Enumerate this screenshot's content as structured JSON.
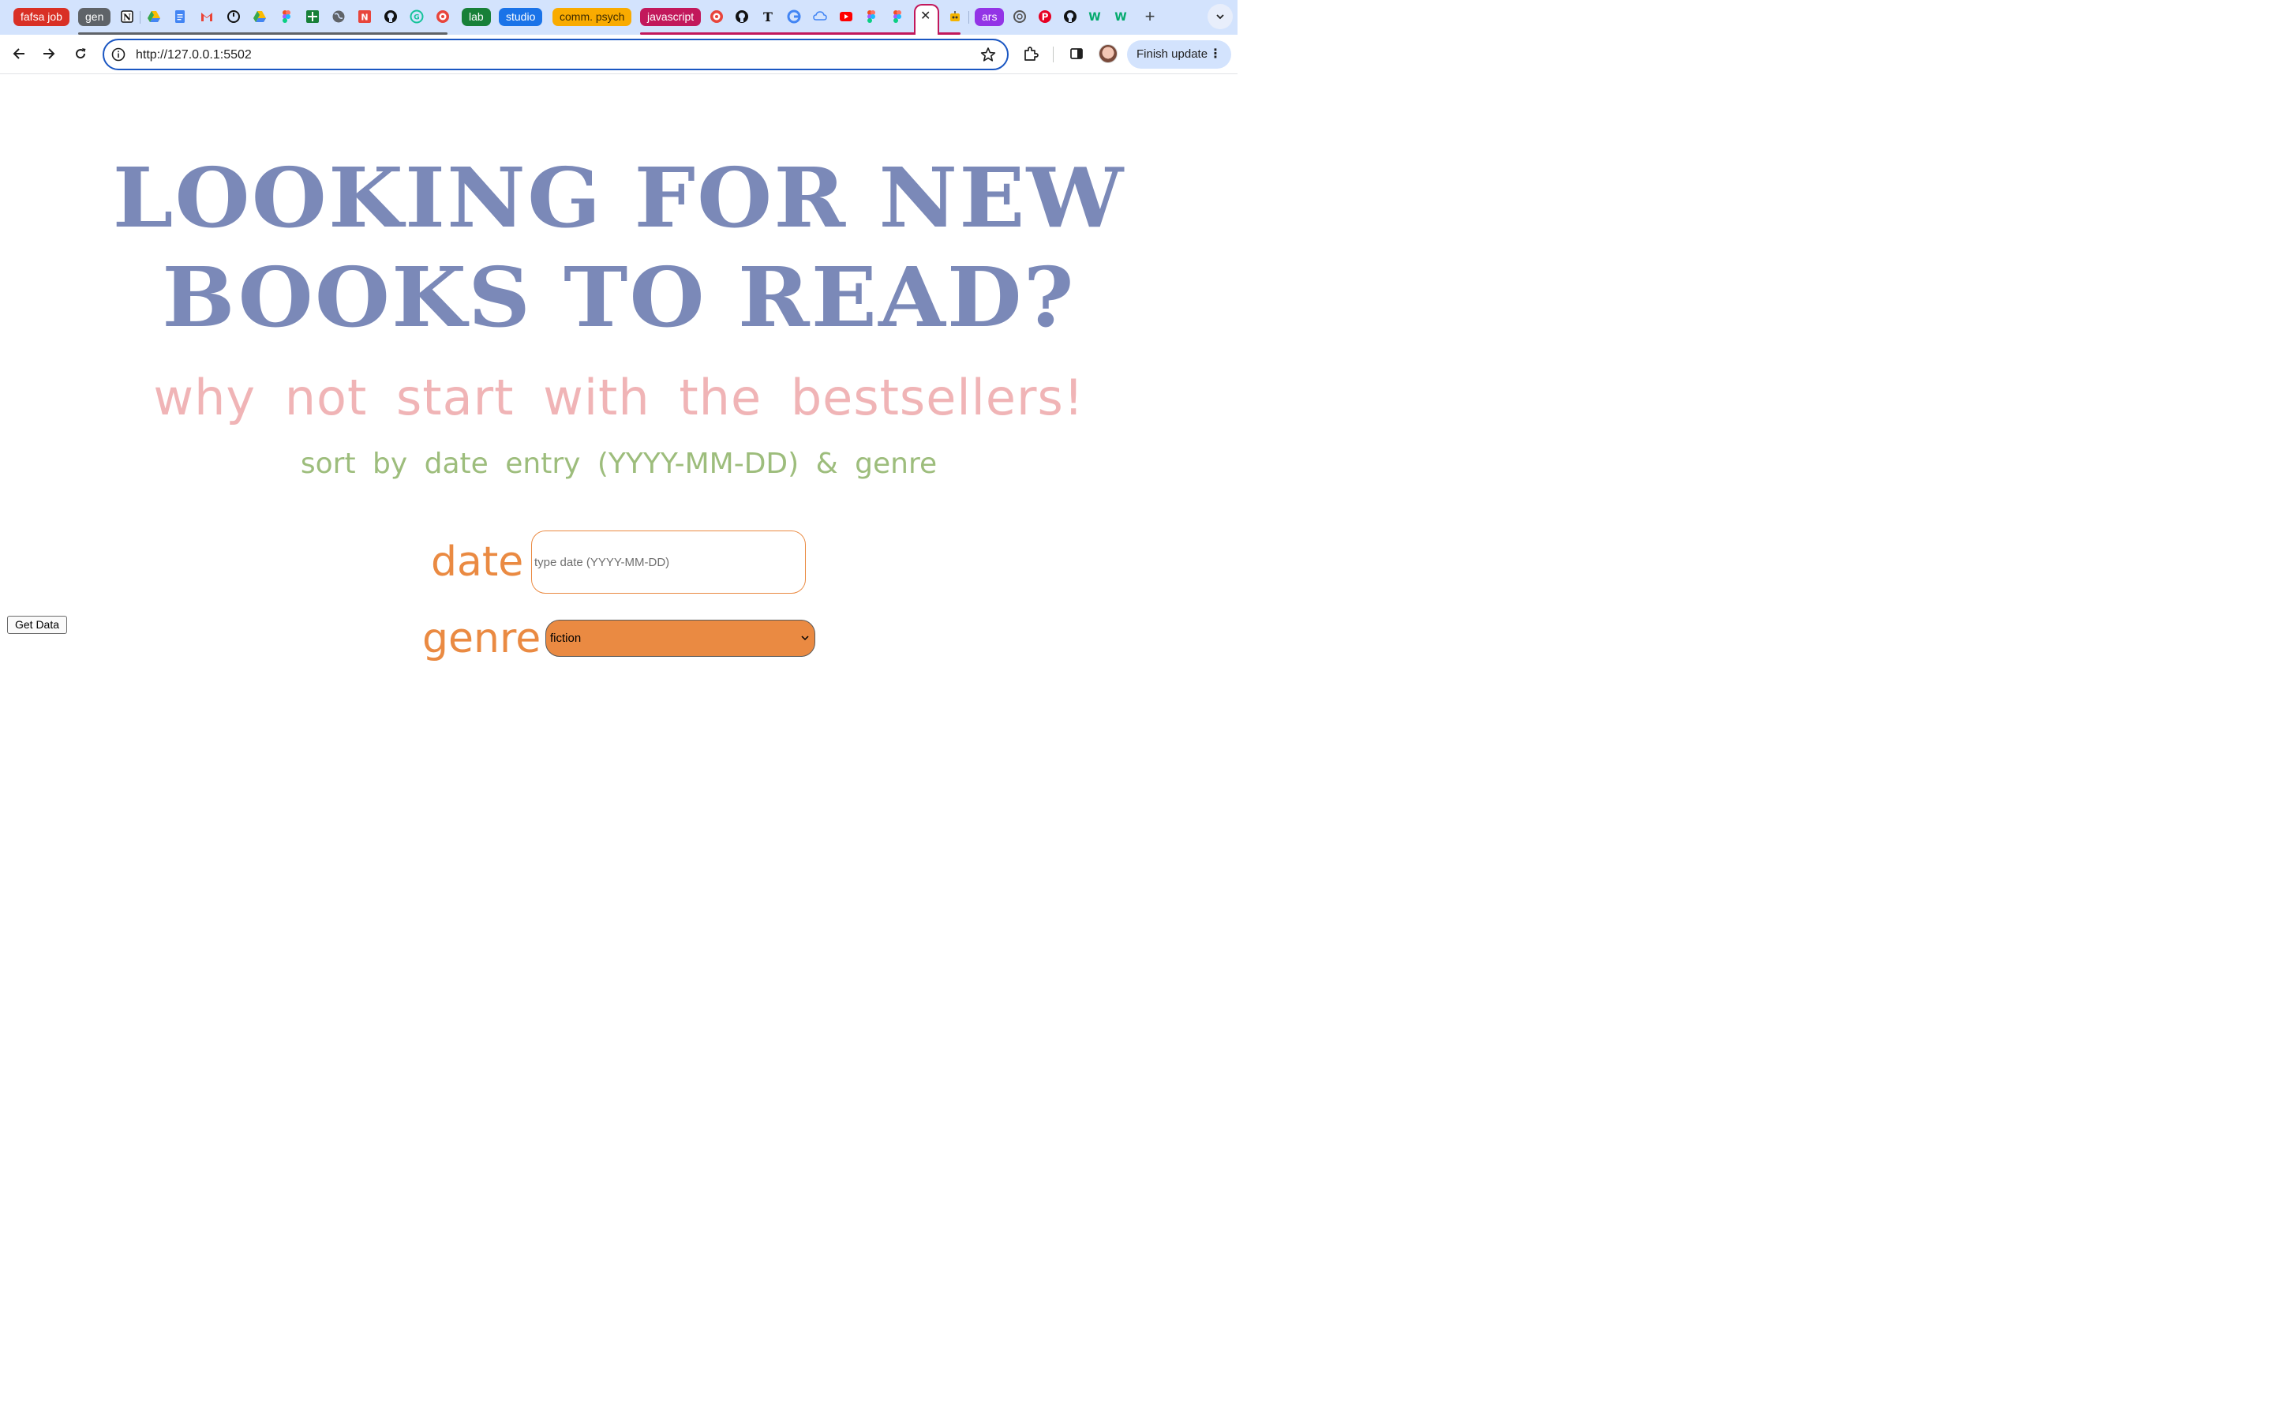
{
  "browser": {
    "tab_groups": [
      {
        "label": "fafsa job",
        "color": "#d93025"
      },
      {
        "label": "gen",
        "color": "#5f6368"
      },
      {
        "label": "lab",
        "color": "#188038"
      },
      {
        "label": "studio",
        "color": "#1a73e8"
      },
      {
        "label": "comm. psych",
        "color": "#f9ab00"
      },
      {
        "label": "javascript",
        "color": "#c2185b"
      },
      {
        "label": "ars",
        "color": "#9334e6"
      }
    ],
    "tab_icons": [
      "notion-icon",
      "google-drive-icon",
      "google-docs-icon",
      "gmail-icon",
      "timer-icon",
      "google-drive-icon",
      "figma-icon",
      "google-sheets-icon",
      "globe-icon",
      "news-icon",
      "github-icon",
      "grammarly-icon",
      "ucla-icon",
      "ucla-icon",
      "github-icon",
      "nytimes-icon",
      "google-icon",
      "cloud-icon",
      "youtube-icon",
      "figma-icon",
      "figma-icon",
      "bot-icon",
      "chatgpt-icon",
      "pinterest-icon",
      "github-icon",
      "w3schools-icon",
      "w3schools-icon"
    ],
    "active_tab_close": "✕",
    "new_tab": "+",
    "address": "http://127.0.0.1:5502",
    "update_button": "Finish update",
    "update_menu": "⋮"
  },
  "page": {
    "headline_line1": "LOOKING FOR NEW",
    "headline_line2": "BOOKS TO READ?",
    "subheadline": "why not start with the bestsellers!",
    "instruction": "sort by date entry (YYYY-MM-DD) & genre",
    "date_label": "date",
    "date_placeholder": "type date (YYYY-MM-DD)",
    "date_value": "",
    "genre_label": "genre",
    "genre_selected": "fiction",
    "get_data_button": "Get Data"
  },
  "colors": {
    "headline": "#7b89b8",
    "subheadline": "#f0b4b6",
    "instruction": "#9dbd7c",
    "form_accent": "#ea8a42",
    "active_tab_outline": "#c2185b",
    "omnibox_focus": "#1a56c2"
  }
}
